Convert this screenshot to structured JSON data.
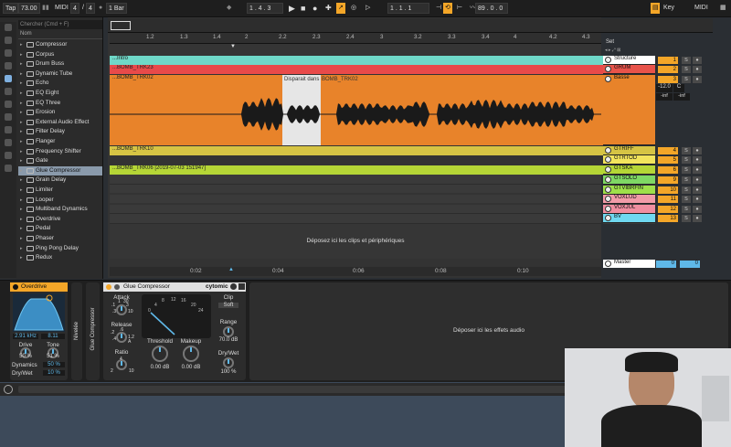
{
  "transport": {
    "tap": "Tap",
    "tempo": "73.00",
    "midi": "MIDI",
    "sig_num": "4",
    "sig_den": "4",
    "quant": "1 Bar",
    "position": "1 . 4 . 3",
    "loop_start": "1 . 1 . 1",
    "loop_len": "89 . 0 . 0",
    "key": "Key",
    "midi_right": "MIDI"
  },
  "browser": {
    "search_placeholder": "Chercher (Cmd + F)",
    "header": "Nom",
    "items": [
      "Compressor",
      "Corpus",
      "Drum Buss",
      "Dynamic Tube",
      "Echo",
      "EQ Eight",
      "EQ Three",
      "Erosion",
      "External Audio Effect",
      "Filter Delay",
      "Flanger",
      "Frequency Shifter",
      "Gate",
      "Glue Compressor",
      "Grain Delay",
      "Limiter",
      "Looper",
      "Multiband Dynamics",
      "Overdrive",
      "Pedal",
      "Phaser",
      "Ping Pong Delay",
      "Redux"
    ],
    "selected": 13
  },
  "ruler": [
    "1.2",
    "1.3",
    "1.4",
    "2",
    "2.2",
    "2.3",
    "2.4",
    "3",
    "3.2",
    "3.3",
    "3.4",
    "4",
    "4.2",
    "4.3"
  ],
  "set_label": "Set",
  "clips": {
    "intro": "...Intro",
    "grum": "...BOMB_TRK23",
    "basse": "...BOMB_TRK02",
    "disparait": "Disparait dans",
    "basse2": "BOMB_TRK02",
    "gtriff": "...BOMB_TRK10",
    "gtska": "...BOMB_TRK06 [2019-07-03 151947]",
    "drop_hint": "Déposez ici les clips et périphériques"
  },
  "tracks": [
    {
      "name": "Structure",
      "color": "#ffffff",
      "num": "1"
    },
    {
      "name": "GRUM",
      "color": "#e8534a",
      "num": "2"
    },
    {
      "name": "Basse",
      "color": "#e8832a",
      "num": "3"
    },
    {
      "name": "GTRIFF",
      "color": "#d6c444",
      "num": "4"
    },
    {
      "name": "GTRTOD",
      "color": "#f2e45c",
      "num": "5"
    },
    {
      "name": "GTSKA",
      "color": "#b5d636",
      "num": "6"
    },
    {
      "name": "GTSOLO",
      "color": "#7fd864",
      "num": "9"
    },
    {
      "name": "GTVIBRFIN",
      "color": "#9ee04a",
      "num": "10"
    },
    {
      "name": "VOXLUD",
      "color": "#f29ba8",
      "num": "11"
    },
    {
      "name": "VOXJUL",
      "color": "#f08ea0",
      "num": "12"
    },
    {
      "name": "BV",
      "color": "#6fd8f0",
      "num": "13"
    }
  ],
  "mixer": {
    "s": "S",
    "c": "C",
    "vol": "-12.0",
    "inf1": "-inf",
    "inf2": "-inf",
    "master": "Master",
    "master_num": "0",
    "master_num2": "0"
  },
  "timeline": [
    "0:02",
    "0:04",
    "0:06",
    "0:08",
    "0:10"
  ],
  "overdrive": {
    "title": "Overdrive",
    "freq": "2.91 kHz",
    "q": "8.11",
    "drive_label": "Drive",
    "drive": "50 %",
    "tone_label": "Tone",
    "tone": "51 %",
    "dyn_label": "Dynamics",
    "dyn": "50 %",
    "dw_label": "Dry/Wet",
    "dw": "10 %"
  },
  "side_labels": {
    "a": "Nivelée",
    "b": "Glue Compressor"
  },
  "glue": {
    "title": "Glue Compressor",
    "brand": "cytomic",
    "attack": "Attack",
    "atk_vals": [
      ".1",
      ".3",
      "1",
      "3",
      "10",
      "30"
    ],
    "release": "Release",
    "rel_vals": [
      ".2",
      ".4",
      ".6",
      "1.2",
      "A"
    ],
    "ratio": "Ratio",
    "ratio_vals": [
      "2",
      "4",
      "10"
    ],
    "threshold": "Threshold",
    "thr_val": "0.00 dB",
    "makeup": "Makeup",
    "mk_val": "0.00 dB",
    "clip": "Clip",
    "soft": "Soft",
    "range": "Range",
    "range_val": "70.0 dB",
    "drywet": "Dry/Wet",
    "dw_val": "100 %",
    "meter": [
      "0",
      "4",
      "8",
      "12",
      "16",
      "20",
      "24"
    ]
  },
  "fx_drop": "Déposer ici les effets audio",
  "colors": {
    "accent": "#f4a628",
    "intro": "#6fd8c8",
    "grum": "#e84a4a",
    "basse": "#e8832a",
    "gtriff": "#d6c444",
    "gtska": "#b5d636"
  }
}
